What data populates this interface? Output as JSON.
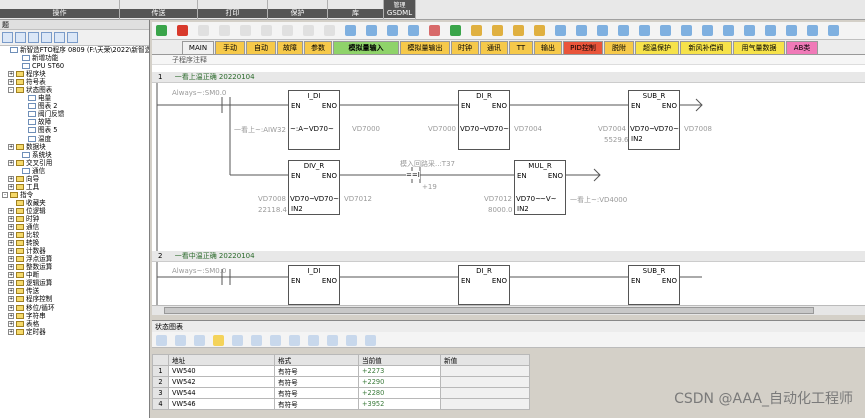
{
  "ribbon": {
    "groups": [
      "操作",
      "传送",
      "打印",
      "保护",
      "库"
    ],
    "extra_label": "GSDML",
    "extra_top": "管理"
  },
  "left_pane": {
    "header": "题",
    "tree": [
      {
        "label": "新智造FTO程序 0809 (F:\\天荣\\2022\\新智造\\",
        "indent": 0,
        "exp": "",
        "icon": "doc"
      },
      {
        "label": "新增功能",
        "indent": 2,
        "exp": "",
        "icon": "doc"
      },
      {
        "label": "CPU ST60",
        "indent": 2,
        "exp": "",
        "icon": "doc"
      },
      {
        "label": "程序块",
        "indent": 1,
        "exp": "+",
        "icon": "folder"
      },
      {
        "label": "符号表",
        "indent": 1,
        "exp": "+",
        "icon": "folder"
      },
      {
        "label": "状态图表",
        "indent": 1,
        "exp": "-",
        "icon": "folder"
      },
      {
        "label": "电量",
        "indent": 3,
        "exp": "",
        "icon": "doc"
      },
      {
        "label": "图表 2",
        "indent": 3,
        "exp": "",
        "icon": "doc"
      },
      {
        "label": "阀门反馈",
        "indent": 3,
        "exp": "",
        "icon": "doc"
      },
      {
        "label": "故障",
        "indent": 3,
        "exp": "",
        "icon": "doc"
      },
      {
        "label": "图表 5",
        "indent": 3,
        "exp": "",
        "icon": "doc"
      },
      {
        "label": "温度",
        "indent": 3,
        "exp": "",
        "icon": "doc"
      },
      {
        "label": "数据块",
        "indent": 1,
        "exp": "+",
        "icon": "folder"
      },
      {
        "label": "系统块",
        "indent": 2,
        "exp": "",
        "icon": "doc"
      },
      {
        "label": "交叉引用",
        "indent": 1,
        "exp": "+",
        "icon": "folder"
      },
      {
        "label": "通信",
        "indent": 2,
        "exp": "",
        "icon": "doc"
      },
      {
        "label": "向导",
        "indent": 1,
        "exp": "+",
        "icon": "folder"
      },
      {
        "label": "工具",
        "indent": 1,
        "exp": "+",
        "icon": "folder"
      },
      {
        "label": "指令",
        "indent": 0,
        "exp": "-",
        "icon": "folder"
      },
      {
        "label": "收藏夹",
        "indent": 1,
        "exp": "",
        "icon": "folder"
      },
      {
        "label": "位逻辑",
        "indent": 1,
        "exp": "+",
        "icon": "folder"
      },
      {
        "label": "时钟",
        "indent": 1,
        "exp": "+",
        "icon": "folder"
      },
      {
        "label": "通信",
        "indent": 1,
        "exp": "+",
        "icon": "folder"
      },
      {
        "label": "比较",
        "indent": 1,
        "exp": "+",
        "icon": "folder"
      },
      {
        "label": "转换",
        "indent": 1,
        "exp": "+",
        "icon": "folder"
      },
      {
        "label": "计数器",
        "indent": 1,
        "exp": "+",
        "icon": "folder"
      },
      {
        "label": "浮点运算",
        "indent": 1,
        "exp": "+",
        "icon": "folder"
      },
      {
        "label": "整数运算",
        "indent": 1,
        "exp": "+",
        "icon": "folder"
      },
      {
        "label": "中断",
        "indent": 1,
        "exp": "+",
        "icon": "folder"
      },
      {
        "label": "逻辑运算",
        "indent": 1,
        "exp": "+",
        "icon": "folder"
      },
      {
        "label": "传送",
        "indent": 1,
        "exp": "+",
        "icon": "folder"
      },
      {
        "label": "程序控制",
        "indent": 1,
        "exp": "+",
        "icon": "folder"
      },
      {
        "label": "移位/循环",
        "indent": 1,
        "exp": "+",
        "icon": "folder"
      },
      {
        "label": "字符串",
        "indent": 1,
        "exp": "+",
        "icon": "folder"
      },
      {
        "label": "表格",
        "indent": 1,
        "exp": "+",
        "icon": "folder"
      },
      {
        "label": "定时器",
        "indent": 1,
        "exp": "+",
        "icon": "folder"
      }
    ]
  },
  "tabs": [
    {
      "label": "MAIN",
      "color": "#f0f0f0",
      "w": 32
    },
    {
      "label": "手动",
      "color": "#f6c94a",
      "w": 30
    },
    {
      "label": "自动",
      "color": "#f6c94a",
      "w": 30
    },
    {
      "label": "故障",
      "color": "#f6c94a",
      "w": 26
    },
    {
      "label": "参数",
      "color": "#f6c94a",
      "w": 28
    },
    {
      "label": "模拟量输入",
      "color": "#8fd36a",
      "w": 66,
      "active": true
    },
    {
      "label": "模拟量输出",
      "color": "#f6c94a",
      "w": 50
    },
    {
      "label": "时钟",
      "color": "#f6c94a",
      "w": 28
    },
    {
      "label": "通讯",
      "color": "#f6c94a",
      "w": 28
    },
    {
      "label": "TT",
      "color": "#f6c94a",
      "w": 24
    },
    {
      "label": "输出",
      "color": "#f6c94a",
      "w": 28
    },
    {
      "label": "PID控制",
      "color": "#e9543a",
      "w": 40
    },
    {
      "label": "脱附",
      "color": "#f6c94a",
      "w": 30
    },
    {
      "label": "超温保护",
      "color": "#f6e24a",
      "w": 44
    },
    {
      "label": "新风补偿阀",
      "color": "#f6e24a",
      "w": 52
    },
    {
      "label": "用气量数据",
      "color": "#f6e24a",
      "w": 52
    },
    {
      "label": "AB类",
      "color": "#f07ab8",
      "w": 32
    }
  ],
  "editor": {
    "subroutine_comment": "子程序注释",
    "networks": [
      {
        "num": "1",
        "title": "一看上温正确 20220104"
      },
      {
        "num": "2",
        "title": "一看中温正确 20220104"
      }
    ],
    "contact_label": "Always~:SM0.0",
    "boxes": {
      "idi": {
        "title": "I_DI",
        "en": "EN",
        "eno": "ENO"
      },
      "dir": {
        "title": "DI_R",
        "en": "EN",
        "eno": "ENO"
      },
      "subr": {
        "title": "SUB_R",
        "en": "EN",
        "eno": "ENO",
        "in2": "IN2"
      },
      "divr": {
        "title": "DIV_R",
        "en": "EN",
        "eno": "ENO",
        "in2": "IN2"
      },
      "mulr": {
        "title": "MUL_R",
        "en": "EN",
        "eno": "ENO",
        "in2": "IN2"
      },
      "cmp": {
        "op": "==I"
      }
    },
    "texts": {
      "aiw": "一看上~:AIW32",
      "vd70a": "~:A~VD70~",
      "vd7000": "VD7000",
      "vd7000b": "VD7000",
      "vd70b": "VD70~",
      "vd70c": "VD70~",
      "vd7004": "VD7004",
      "vd7004b": "VD7004",
      "vd70d": "VD70~",
      "vd70e": "VD70~",
      "vd7008": "VD7008",
      "val5529": "5529.6",
      "vd7008b": "VD7008",
      "vd70f": "VD70~",
      "vd70g": "VD70~",
      "vd7012": "VD7012",
      "val22118": "22118.4",
      "t37": "模入回路采..:T37",
      "plus19": "+19",
      "vd7012b": "VD7012",
      "vd70h": "VD70~",
      "v70": "~V~",
      "vd4000": "一看上~:VD4000",
      "val8000": "8000.0"
    }
  },
  "status_chart": {
    "title": "状态图表",
    "headers": [
      "",
      "地址",
      "格式",
      "当前值",
      "新值"
    ],
    "rows": [
      {
        "n": "1",
        "addr": "VW540",
        "fmt": "有符号",
        "cur": "+2273",
        "new": ""
      },
      {
        "n": "2",
        "addr": "VW542",
        "fmt": "有符号",
        "cur": "+2290",
        "new": ""
      },
      {
        "n": "3",
        "addr": "VW544",
        "fmt": "有符号",
        "cur": "+2280",
        "new": ""
      },
      {
        "n": "4",
        "addr": "VW546",
        "fmt": "有符号",
        "cur": "+3952",
        "new": ""
      }
    ]
  },
  "watermark": "CSDN @AAA_自动化工程师"
}
